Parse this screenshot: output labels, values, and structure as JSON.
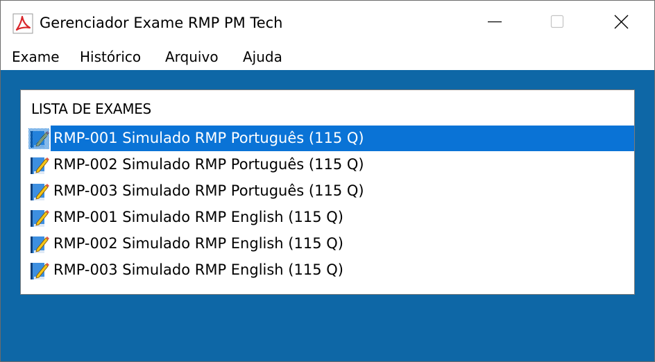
{
  "window": {
    "title": "Gerenciador Exame RMP PM Tech",
    "app_icon": "acrobat-icon",
    "controls": [
      "minimize-icon",
      "maximize-icon",
      "close-icon"
    ]
  },
  "menu": {
    "items": [
      {
        "label": "Exame"
      },
      {
        "label": "Histórico"
      },
      {
        "label": "Arquivo"
      },
      {
        "label": "Ajuda"
      }
    ]
  },
  "exam_list": {
    "title": "LISTA DE EXAMES",
    "item_icon": "book-pencil-icon",
    "selected_index": 0,
    "items": [
      {
        "label": "RMP-001 Simulado RMP Português (115 Q)"
      },
      {
        "label": "RMP-002 Simulado RMP Português (115 Q)"
      },
      {
        "label": "RMP-003 Simulado RMP Português (115 Q)"
      },
      {
        "label": "RMP-001 Simulado RMP English (115 Q)"
      },
      {
        "label": "RMP-002 Simulado RMP English (115 Q)"
      },
      {
        "label": "RMP-003 Simulado RMP English (115 Q)"
      }
    ]
  },
  "colors": {
    "background": "#0e67a6",
    "selection": "#0a73d6",
    "titlebar": "#ffffff"
  }
}
